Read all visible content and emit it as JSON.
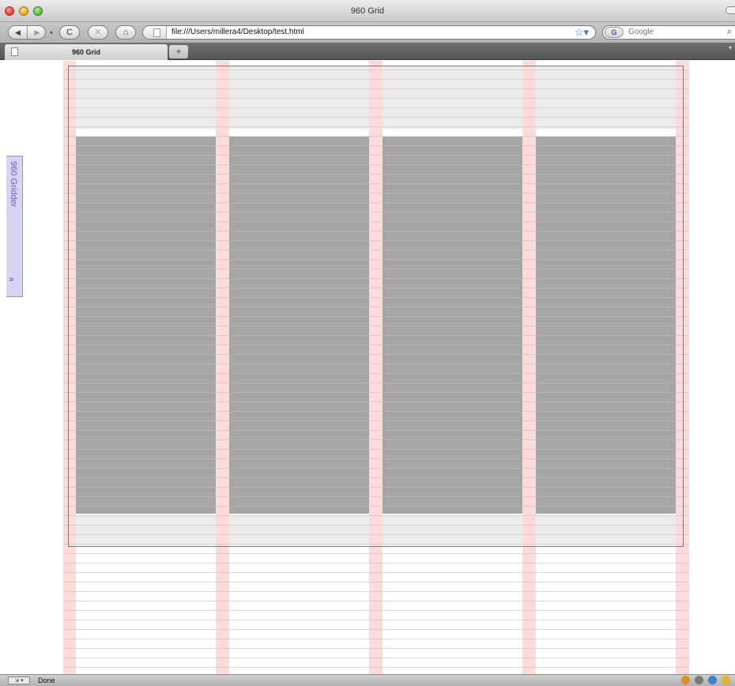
{
  "window": {
    "title": "960 Grid"
  },
  "toolbar": {
    "back_icon": "◀",
    "forward_icon": "▶",
    "dropdown_dot": "▾",
    "reload_icon": "C",
    "stop_icon": "✕",
    "home_icon": "⌂",
    "url": "file:///Users/millera4/Desktop/test.html",
    "bookmark_icon": "☆▾",
    "search_engine_icon": "G",
    "search_placeholder": "Google",
    "search_icon": "🔍"
  },
  "tabs": {
    "active_label": "960 Grid",
    "new_tab_icon": "+"
  },
  "gridder": {
    "label": "960 Gridder",
    "toggle_icon": "»"
  },
  "status": {
    "button_icon": "⇲ ▾",
    "text": "Done"
  },
  "colors": {
    "gutter": "#ffcccc",
    "block": "#a6a6a6",
    "gridder_panel": "#d6d4f0",
    "gridder_text": "#6a5fc0"
  }
}
